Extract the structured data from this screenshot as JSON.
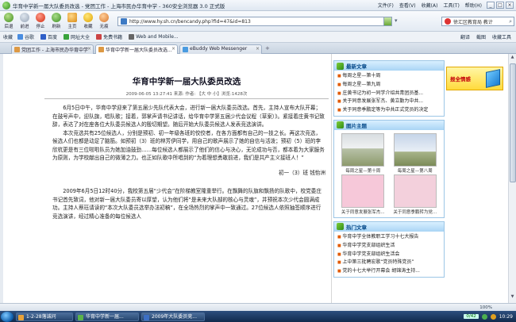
{
  "window": {
    "title": "华育中学新一届大队委员改选 - 党团工作 - 上海市民办华育中学 - 360安全浏览器 3.0 正式版",
    "menu": [
      "文件(F)",
      "查看(V)",
      "收藏(A)",
      "工具(T)",
      "帮助(H)"
    ],
    "controls": [
      "_",
      "□",
      "×"
    ]
  },
  "nav": {
    "buttons": [
      "后退",
      "前进",
      "停止",
      "刷新",
      "主页",
      "收藏",
      "无痕"
    ],
    "url": "http://www.hy.sh.cn/bencandy.php?fid=47&id=813",
    "search_text": "徐汇区教育局 教计"
  },
  "favorites": {
    "label": "收藏",
    "items": [
      "谷歌",
      "百度",
      "网址大全",
      "免费书籍",
      "Web and Mobile..."
    ],
    "right": [
      "翻译",
      "截图",
      "收藏工具"
    ]
  },
  "tabs": [
    {
      "label": "党团工作 - 上海市民办华育中学",
      "active": false
    },
    {
      "label": "华育中学新一届大队委员改选...",
      "active": true
    },
    {
      "label": "eBuddy Web Messenger",
      "active": false
    }
  ],
  "article": {
    "title": "华育中学新一届大队委员改选",
    "meta": "2009-06-05 13:27:41  来源:  作者: 【大  中  小】浏览:1428次",
    "paragraphs": [
      "6月5日中午，华育中学迎来了第五届少先队代表大会，进行新一届大队委员改选。首先，主持人宣布大队开幕；在鼓号声中，迎队旗，唱队歌；接着，郭掌声请书记讲话，给华育中学第五届少代会议程（草案）》。紧接着庄黄书记致辞，表达了对在座各位大队委员候选人的殷切期望。随后开始大队委员候选人发表竞选演讲。",
      "本次竞选共有25位候选人，分别是预初、初一年级各班的佼佼者，在各方面都有自己的一技之长。再这次竞选，候选人们也都是动足了脑筋。如预初（3）班的林芳伊同学，用自己的歌声展示了她的自信与活泼；预初（5）班的李欣杭更是有三位啦啦队员为她加油鼓劲……每位候选人都展示了他们的信心与决心，无论成功与否，都本着为大家服务为原则，为学校献出自己的微薄之力。也正如队歌中所唱到的“为着理想勇敢前进，我们是共产主义接班人！”"
    ],
    "signature": "初一（3）班  钱怡洲",
    "paragraphs2": [
      "2009年6月5日12时40分，我校第五届“少代会”在阶梯教室隆重举行。在飘舞的队旗和飘扬的队歌中，校党委庄书记首先致词，他对新一届大队委员寄以厚望，认为他们将“是未来大队部的核心与灵魂”，并预祝本次少代会圆满成功。主持人蔡珏请读的“本次大队委员选举办法初稿”，在全场热烈的掌声中一致通过。27位候选人依照抽签顺序进行竞选演讲，经过精心准备的每位候选人"
    ]
  },
  "sidebar": {
    "news_title": "最新文章",
    "news": [
      "每周之星—第十周",
      "每周之星—第九周",
      "庄黄书记为初一同学介绍共青团员基...",
      "关于同意发展张军杰、黄立勤为中共...",
      "关于同意季鹏定等为中共正式党员的决定"
    ],
    "photos_title": "图片主题",
    "photos": [
      "每周之星—第十周",
      "每周之星—第八周",
      "关于同意发展张军杰...",
      "关于同意季鹏转为党..."
    ],
    "hot_title": "热门文章",
    "hot": [
      "华育中学全体教职工学习十七大报告",
      "华育中学党支部组织生活",
      "华育中学党支部组织生活会",
      "上中第三批聘宏歌“党员特殊党员”",
      "党的十七大举行开幕会  胡锦涛主持..."
    ]
  },
  "ad": {
    "label": "报全情感"
  },
  "status": {
    "text": "",
    "zoom": "100%"
  },
  "taskbar": {
    "items": [
      "1-2-28落诚问",
      "华育中学新一届...",
      "2009年大队委员竞..."
    ],
    "tray_indicator": "0/42",
    "clock": "10:29"
  }
}
